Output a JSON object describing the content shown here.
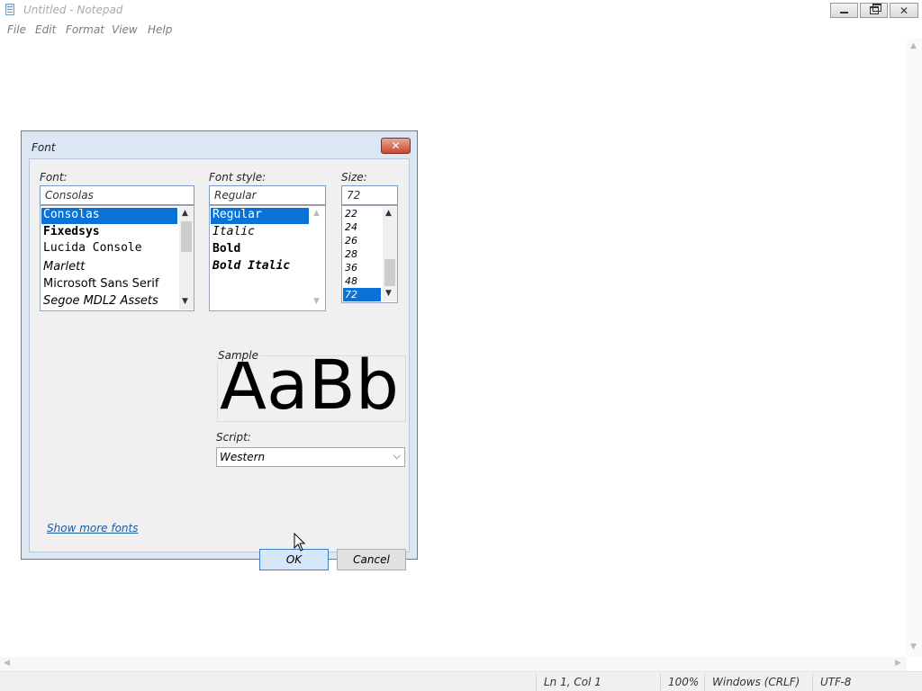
{
  "window": {
    "title": "Untitled - Notepad",
    "menu": [
      "File",
      "Edit",
      "Format",
      "View",
      "Help"
    ]
  },
  "status_bar": {
    "position": "Ln 1, Col 1",
    "zoom": "100%",
    "line_ending": "Windows (CRLF)",
    "encoding": "UTF-8"
  },
  "dialog": {
    "title": "Font",
    "close_label": "✕",
    "font_label": "Font:",
    "font_value": "Consolas",
    "font_list": [
      "Consolas",
      "Fixedsys",
      "Lucida Console",
      "Marlett",
      "Microsoft Sans Serif",
      "Segoe MDL2 Assets"
    ],
    "style_label": "Font style:",
    "style_value": "Regular",
    "style_list": [
      "Regular",
      "Italic",
      "Bold",
      "Bold Italic"
    ],
    "size_label": "Size:",
    "size_value": "72",
    "size_list": [
      "22",
      "24",
      "26",
      "28",
      "36",
      "48",
      "72"
    ],
    "sample_label": "Sample",
    "sample_text": "AaBb",
    "script_label": "Script:",
    "script_value": "Western",
    "more_fonts_link": "Show more fonts",
    "ok_label": "OK",
    "cancel_label": "Cancel"
  }
}
